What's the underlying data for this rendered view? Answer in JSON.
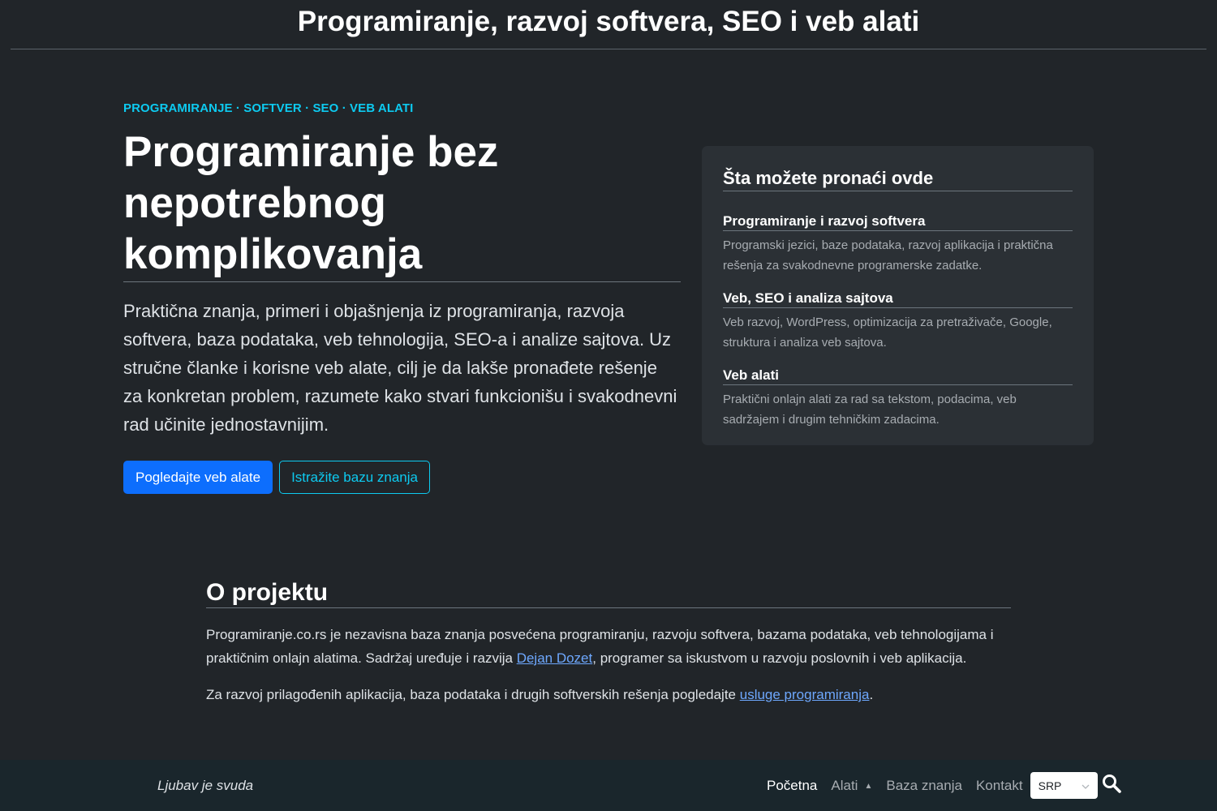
{
  "header": {
    "title": "Programiranje, razvoj softvera, SEO i veb alati"
  },
  "hero": {
    "eyebrow": "PROGRAMIRANJE · SOFTVER · SEO · VEB ALATI",
    "heading": "Programiranje bez nepotrebnog komplikovanja",
    "lead": "Praktična znanja, primeri i objašnjenja iz programiranja, razvoja softvera, baza podataka, veb tehnologija, SEO-a i analize sajtova. Uz stručne članke i korisne veb alate, cilj je da lakše pronađete rešenje za konkretan problem, razumete kako stvari funkcionišu i svakodnevni rad učinite jednostavnijim.",
    "primary_button": "Pogledajte veb alate",
    "secondary_button": "Istražite bazu znanja"
  },
  "card": {
    "title": "Šta možete pronaći ovde",
    "sections": [
      {
        "title": "Programiranje i razvoj softvera",
        "text": "Programski jezici, baze podataka, razvoj aplikacija i praktična rešenja za svakodnevne programerske zadatke."
      },
      {
        "title": "Veb, SEO i analiza sajtova",
        "text": "Veb razvoj, WordPress, optimizacija za pretraživače, Google, struktura i analiza veb sajtova."
      },
      {
        "title": "Veb alati",
        "text": "Praktični onlajn alati za rad sa tekstom, podacima, veb sadržajem i drugim tehničkim zadacima."
      }
    ]
  },
  "about": {
    "title": "O projektu",
    "p1_before": "Programiranje.co.rs je nezavisna baza znanja posvećena programiranju, razvoju softvera, bazama podataka, veb tehnologijama i praktičnim onlajn alatima. Sadržaj uređuje i razvija ",
    "p1_link": "Dejan Dozet",
    "p1_after": ", programer sa iskustvom u razvoju poslovnih i veb aplikacija.",
    "p2_before": "Za razvoj prilagođenih aplikacija, baza podataka i drugih softverskih rešenja pogledajte ",
    "p2_link": "usluge programiranja",
    "p2_after": "."
  },
  "footer": {
    "tagline": "Ljubav je svuda",
    "nav": {
      "home": "Početna",
      "tools": "Alati",
      "knowledge": "Baza znanja",
      "contact": "Kontakt"
    },
    "language": "SRP",
    "icons": {
      "search": "search-icon",
      "dropdown": "caret-up-icon",
      "select": "chevron-down-icon"
    }
  },
  "colors": {
    "background": "#212529",
    "accent_cyan": "#0dcaf0",
    "primary_blue": "#0d6efd",
    "link": "#6ea8fe",
    "card": "#2b3035",
    "footer": "#1a262c"
  }
}
